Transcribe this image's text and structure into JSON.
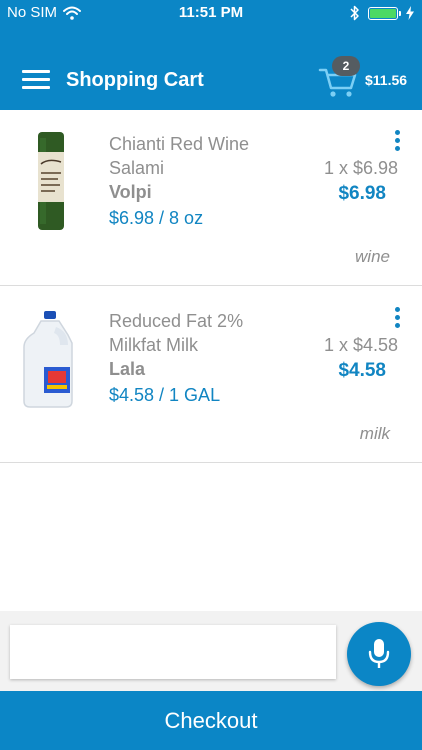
{
  "status_bar": {
    "carrier": "No SIM",
    "time": "11:51 PM"
  },
  "header": {
    "title": "Shopping Cart",
    "cart_count": "2",
    "cart_total": "$11.56"
  },
  "items": [
    {
      "name": "Chianti Red Wine Salami",
      "brand": "Volpi",
      "unit_price": "$6.98 / 8 oz",
      "quantity_line": "1 x $6.98",
      "line_total": "$6.98",
      "tag": "wine"
    },
    {
      "name": "Reduced Fat 2% Milkfat Milk",
      "brand": "Lala",
      "unit_price": "$4.58 / 1 GAL",
      "quantity_line": "1 x $4.58",
      "line_total": "$4.58",
      "tag": "milk"
    }
  ],
  "search": {
    "value": "",
    "placeholder": ""
  },
  "checkout": {
    "label": "Checkout"
  },
  "colors": {
    "primary": "#0b86c6",
    "price": "#1185c2",
    "muted_text": "#8f8f8f",
    "battery": "#4cd964",
    "badge": "#555c61"
  }
}
